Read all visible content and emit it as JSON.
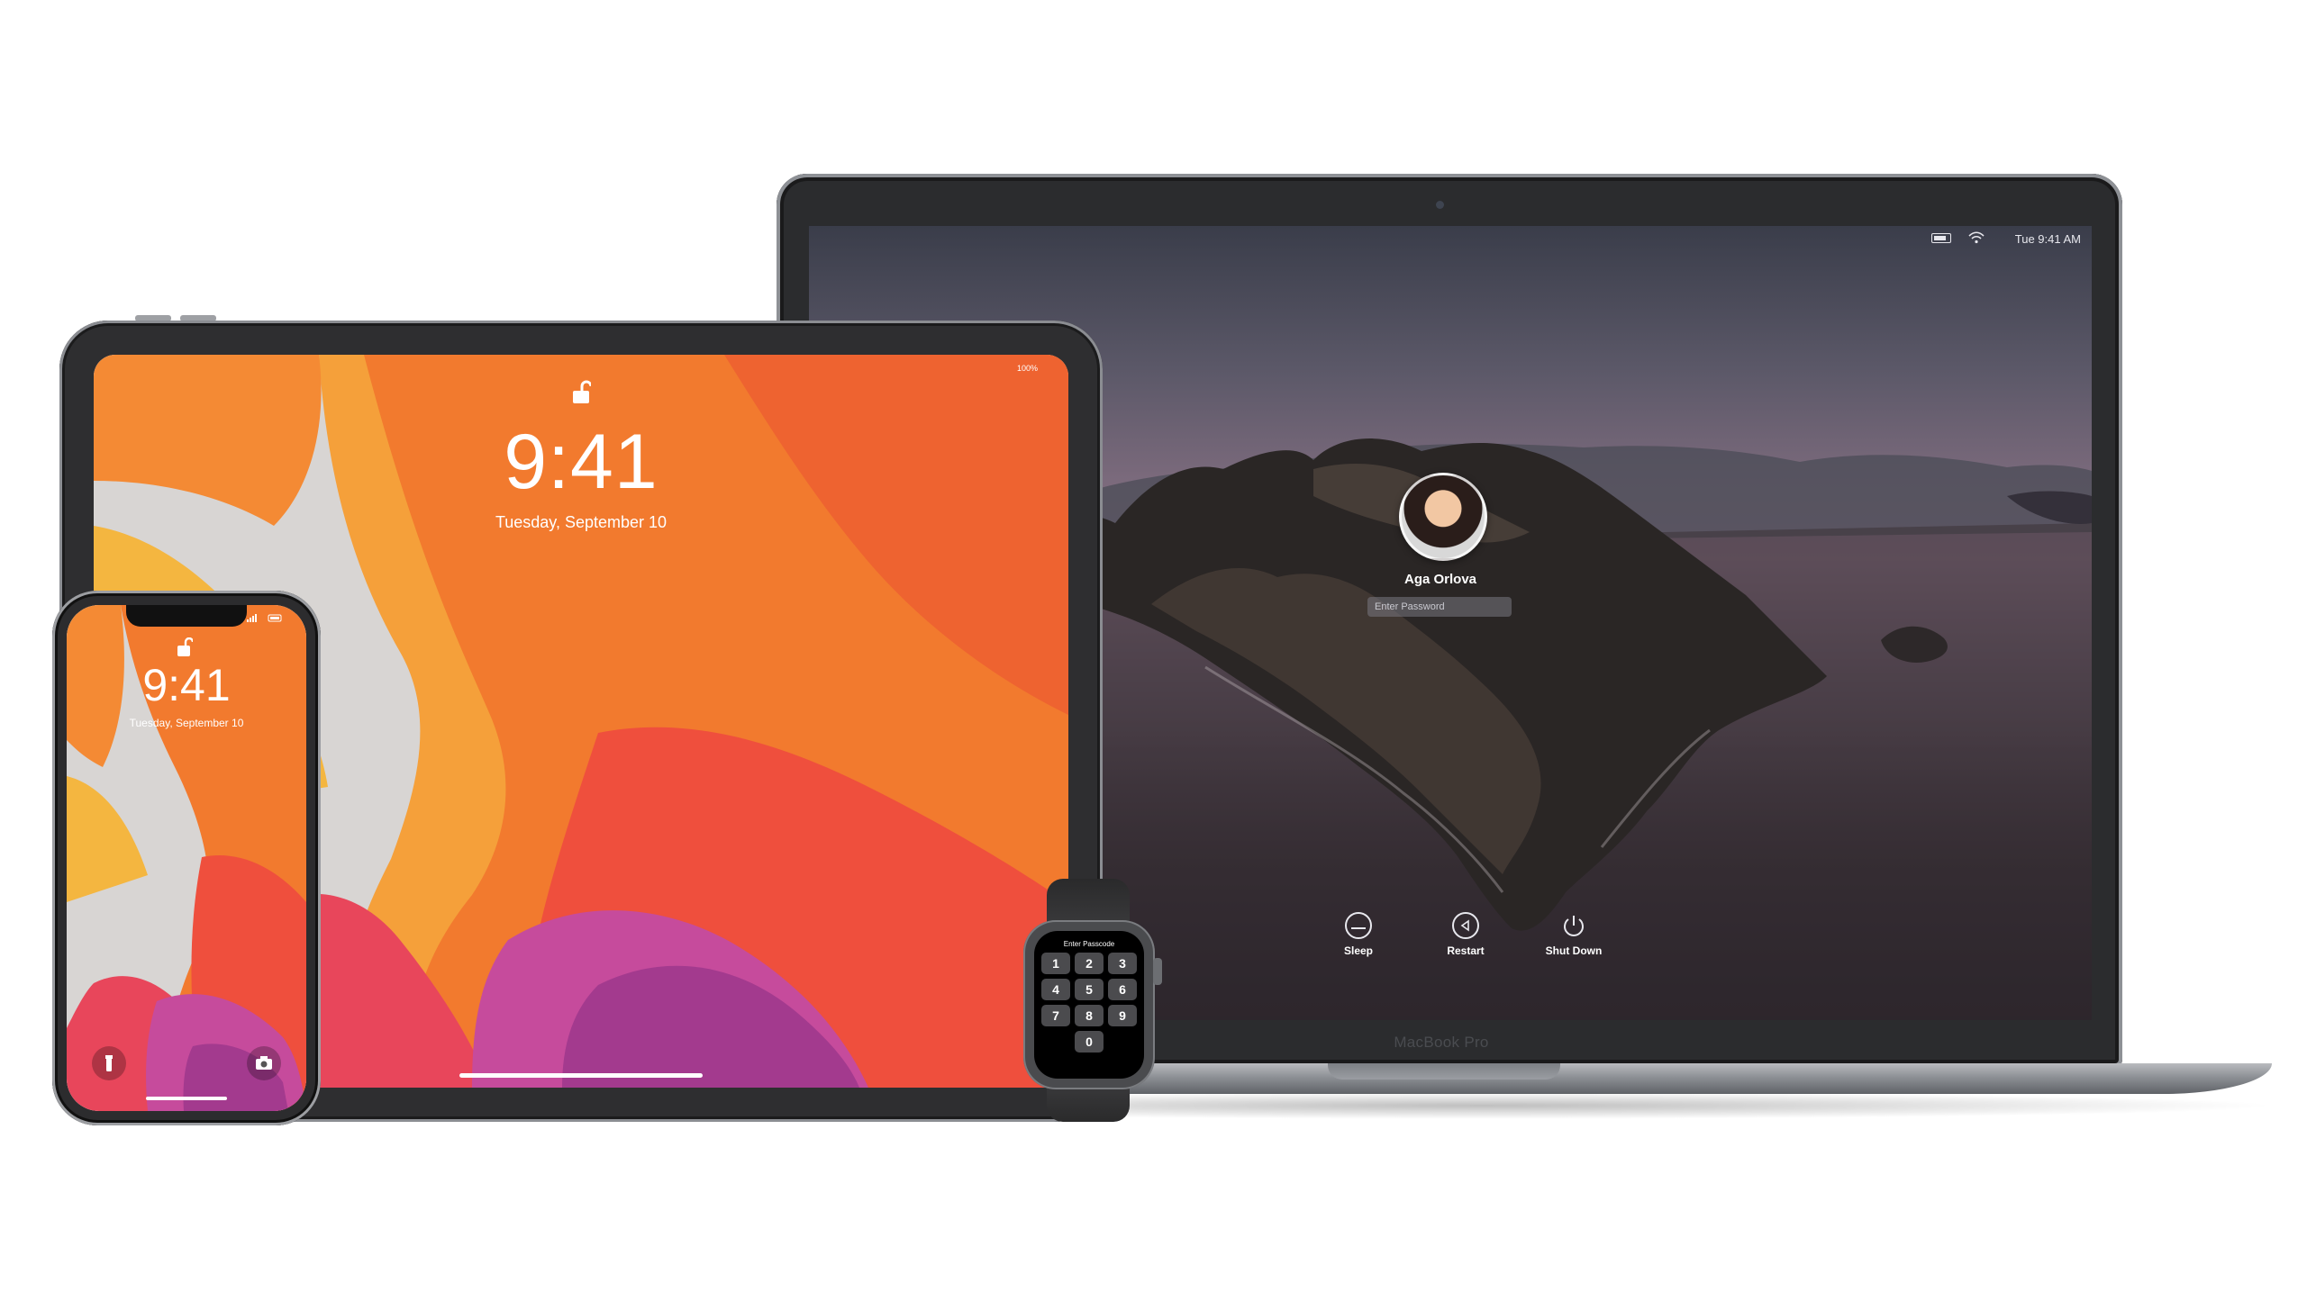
{
  "macbook": {
    "brand": "MacBook Pro",
    "status_time": "Tue 9:41 AM",
    "user_name": "Aga Orlova",
    "password_placeholder": "Enter Password",
    "buttons": {
      "sleep": "Sleep",
      "restart": "Restart",
      "shutdown": "Shut Down"
    }
  },
  "ipad": {
    "time": "9:41",
    "date": "Tuesday, September 10",
    "status": "100%"
  },
  "iphone": {
    "time": "9:41",
    "date": "Tuesday, September 10"
  },
  "watch": {
    "title": "Enter Passcode",
    "keys": [
      "1",
      "2",
      "3",
      "4",
      "5",
      "6",
      "7",
      "8",
      "9",
      "0"
    ]
  },
  "icons": {
    "lock": "unlocked-padlock-icon",
    "wifi": "wifi-icon",
    "battery": "battery-icon",
    "sleep": "sleep-icon",
    "restart": "restart-icon",
    "shutdown": "power-icon",
    "flashlight": "flashlight-icon",
    "camera": "camera-icon"
  },
  "colors": {
    "wallpaper_orange": "#f26a2e",
    "wallpaper_yellow": "#f6b13a",
    "wallpaper_magenta": "#c2307a",
    "device_space_gray": "#2e2e30"
  }
}
